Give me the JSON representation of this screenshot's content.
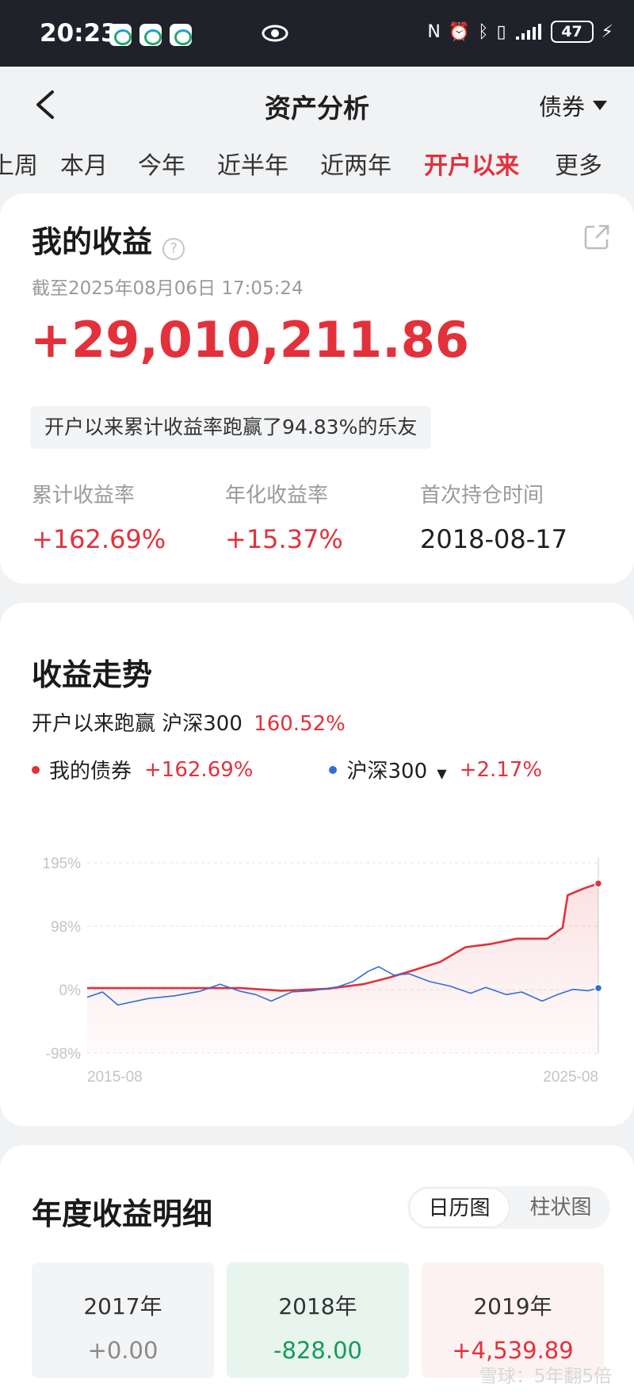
{
  "status_bar": {
    "time": "20:23",
    "battery": "47"
  },
  "header": {
    "title": "资产分析",
    "asset_type": "债券"
  },
  "tabs": [
    "上周",
    "本月",
    "今年",
    "近半年",
    "近两年",
    "开户以来",
    "更多"
  ],
  "active_tab": "开户以来",
  "income": {
    "heading": "我的收益",
    "help": "?",
    "cutoff": "截至2025年08月06日 17:05:24",
    "total": "+29,010,211.86",
    "beat_text": "开户以来累计收益率跑赢了94.83%的乐友",
    "kpis": [
      {
        "label": "累计收益率",
        "value": "+162.69%"
      },
      {
        "label": "年化收益率",
        "value": "+15.37%"
      },
      {
        "label": "首次持仓时间",
        "value": "2018-08-17"
      }
    ]
  },
  "trend": {
    "heading": "收益走势",
    "compare_prefix": "开户以来跑赢 沪深300",
    "compare_value": "160.52%",
    "legend": [
      {
        "name": "我的债券",
        "value": "+162.69%",
        "color": "#e3313b"
      },
      {
        "name": "沪深300",
        "value": "+2.17%",
        "color": "#2f6fd6"
      }
    ]
  },
  "chart_data": {
    "type": "line",
    "y_ticks": [
      "195%",
      "98%",
      "0%",
      "-98%"
    ],
    "ylim": [
      -98,
      195
    ],
    "x_ticks": [
      "2015-08",
      "2025-08"
    ],
    "xlim": [
      2015.6,
      2025.6
    ],
    "series": [
      {
        "name": "我的债券",
        "color": "#e3313b",
        "x": [
          2015.6,
          2018.6,
          2019.4,
          2020.3,
          2021.0,
          2021.5,
          2022.0,
          2022.5,
          2023.0,
          2023.5,
          2024.0,
          2024.6,
          2024.9,
          2025.0,
          2025.3,
          2025.6
        ],
        "y": [
          2,
          2,
          -2,
          1,
          8,
          18,
          30,
          42,
          65,
          70,
          78,
          78,
          95,
          145,
          155,
          163
        ]
      },
      {
        "name": "沪深300",
        "color": "#2f6fd6",
        "x": [
          2015.6,
          2015.9,
          2016.2,
          2016.8,
          2017.3,
          2017.8,
          2018.2,
          2018.6,
          2018.9,
          2019.2,
          2019.6,
          2020.0,
          2020.5,
          2020.8,
          2021.1,
          2021.3,
          2021.6,
          2021.9,
          2022.3,
          2022.7,
          2023.1,
          2023.4,
          2023.8,
          2024.1,
          2024.5,
          2024.8,
          2025.1,
          2025.4,
          2025.6
        ],
        "y": [
          -12,
          -4,
          -24,
          -14,
          -10,
          -3,
          8,
          -3,
          -8,
          -18,
          -4,
          -2,
          4,
          12,
          28,
          35,
          22,
          24,
          12,
          5,
          -6,
          3,
          -8,
          -4,
          -18,
          -8,
          0,
          -2,
          2
        ]
      }
    ]
  },
  "yearly": {
    "heading": "年度收益明细",
    "toggle": [
      "日历图",
      "柱状图"
    ],
    "cards": [
      {
        "year": "2017年",
        "value": "+0.00"
      },
      {
        "year": "2018年",
        "value": "-828.00"
      },
      {
        "year": "2019年",
        "value": "+4,539.89"
      }
    ]
  },
  "watermark": "雪球：5年翻5倍"
}
